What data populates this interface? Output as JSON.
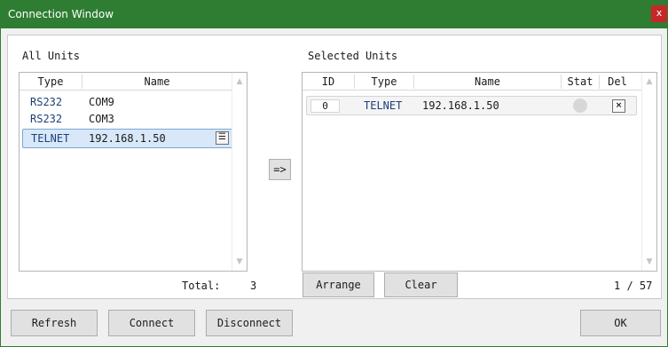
{
  "window": {
    "title": "Connection Window",
    "close_glyph": "x"
  },
  "all_units": {
    "label": "All Units",
    "columns": {
      "type": "Type",
      "name": "Name"
    },
    "rows": [
      {
        "type": "RS232",
        "name": "COM9"
      },
      {
        "type": "RS232",
        "name": "COM3"
      },
      {
        "type": "TELNET",
        "name": "192.168.1.50",
        "menu_glyph": "☰"
      }
    ],
    "total_label": "Total:",
    "total_value": "3"
  },
  "transfer_button": {
    "label": "=>"
  },
  "selected_units": {
    "label": "Selected Units",
    "columns": {
      "id": "ID",
      "type": "Type",
      "name": "Name",
      "stat": "Stat",
      "del": "Del"
    },
    "rows": [
      {
        "id": "0",
        "type": "TELNET",
        "name": "192.168.1.50",
        "del_glyph": "×"
      }
    ],
    "arrange_label": "Arrange",
    "clear_label": "Clear",
    "page_indicator": "1 / 57"
  },
  "footer": {
    "refresh_label": "Refresh",
    "connect_label": "Connect",
    "disconnect_label": "Disconnect",
    "ok_label": "OK"
  },
  "colors": {
    "titlebar": "#2e7d32",
    "close": "#c62828",
    "selection": "#d8e8f8"
  },
  "icons": {
    "close": "close-icon",
    "menu": "menu-icon",
    "delete": "delete-icon",
    "status": "status-indicator"
  }
}
